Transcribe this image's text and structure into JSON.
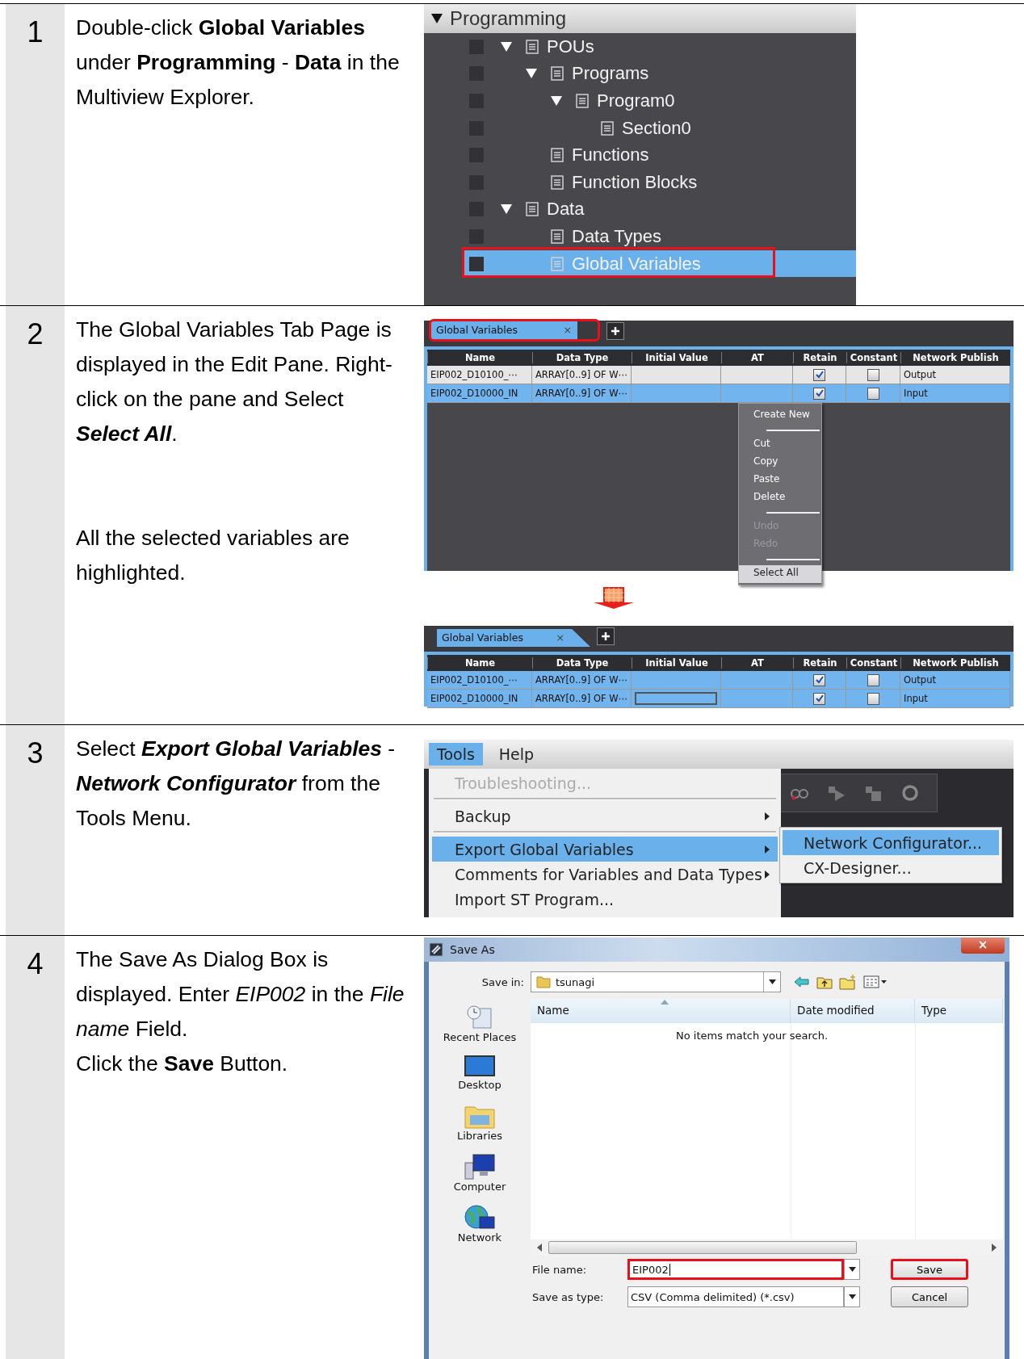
{
  "steps": [
    {
      "number": "1",
      "paragraphs": [
        {
          "kind": "note",
          "text": "Double-click **Global Variables** under **Programming** - **Data** in the Multiview Explorer."
        }
      ],
      "screens": [
        {
          "kind": "tree",
          "header": {
            "label": "Programming",
            "expanded": true
          },
          "items": [
            {
              "label": "POUs",
              "expanded": true,
              "selected": false,
              "marked": false,
              "children": [
                {
                  "label": "Programs",
                  "expanded": true,
                  "selected": false,
                  "marked": false,
                  "children": [
                    {
                      "label": "Program0",
                      "expanded": true,
                      "selected": false,
                      "marked": false,
                      "children": [
                        {
                          "label": "Section0",
                          "selected": false,
                          "marked": false
                        }
                      ]
                    }
                  ]
                },
                {
                  "label": "Functions",
                  "selected": false,
                  "marked": false
                },
                {
                  "label": "Function Blocks",
                  "selected": false,
                  "marked": false
                }
              ]
            },
            {
              "label": "Data",
              "expanded": true,
              "selected": false,
              "marked": false,
              "children": [
                {
                  "label": "Data Types",
                  "selected": false,
                  "marked": false
                },
                {
                  "label": "Global Variables",
                  "selected": true,
                  "marked": true
                }
              ]
            }
          ]
        }
      ]
    },
    {
      "number": "2",
      "paragraphs": [
        {
          "kind": "command",
          "text": "The Global Variables Tab Page is displayed in the Edit Pane. Right-click on the pane and Select **Select All**."
        },
        {
          "kind": "note",
          "text": "All the selected variables are highlighted."
        }
      ],
      "screens": [
        {
          "kind": "grid",
          "tabs": [
            {
              "label": "Global Variables",
              "close": "×",
              "selected": true,
              "marked": true
            }
          ],
          "columns": [
            "Name",
            "Data Type",
            "Initial Value",
            "AT",
            "Retain",
            "Constant",
            "Network Publish"
          ],
          "rows": [
            {
              "name": "EIP002_D10100_⋯",
              "data_type": "ARRAY[0..9] OF W⋯",
              "retain": true,
              "constant": false,
              "network_publish": "Output",
              "selected": false,
              "editing": false
            },
            {
              "name": "EIP002_D10000_IN",
              "data_type": "ARRAY[0..9] OF W⋯",
              "retain": true,
              "constant": false,
              "network_publish": "Input",
              "selected": true,
              "editing": false
            }
          ],
          "context_menu": [
            {
              "kind": "item",
              "label": "Create New",
              "disabled": false,
              "selected": false
            },
            {
              "kind": "separator"
            },
            {
              "kind": "item",
              "label": "Cut",
              "disabled": false,
              "selected": false
            },
            {
              "kind": "item",
              "label": "Copy",
              "disabled": false,
              "selected": false
            },
            {
              "kind": "item",
              "label": "Paste",
              "disabled": false,
              "selected": false
            },
            {
              "kind": "item",
              "label": "Delete",
              "disabled": false,
              "selected": false
            },
            {
              "kind": "separator"
            },
            {
              "kind": "item",
              "label": "Undo",
              "disabled": true,
              "selected": false
            },
            {
              "kind": "item",
              "label": "Redo",
              "disabled": true,
              "selected": false
            },
            {
              "kind": "separator"
            },
            {
              "kind": "item",
              "label": "Select All",
              "disabled": false,
              "selected": true
            }
          ]
        },
        {
          "kind": "arrow"
        },
        {
          "kind": "grid",
          "tabs": [
            {
              "label": "Global Variables",
              "close": "×",
              "selected": true,
              "marked": false
            }
          ],
          "columns": [
            "Name",
            "Data Type",
            "Initial Value",
            "AT",
            "Retain",
            "Constant",
            "Network Publish"
          ],
          "rows": [
            {
              "name": "EIP002_D10100_⋯",
              "data_type": "ARRAY[0..9] OF W⋯",
              "retain": true,
              "constant": false,
              "network_publish": "Output",
              "selected": true,
              "editing": false
            },
            {
              "name": "EIP002_D10000_IN",
              "data_type": "ARRAY[0..9] OF W⋯",
              "retain": true,
              "constant": false,
              "network_publish": "Input",
              "selected": true,
              "editing": true
            }
          ]
        }
      ]
    },
    {
      "number": "3",
      "paragraphs": [
        {
          "kind": "command",
          "text": "Select **Export Global Variables** - **Network Configurator** from the Tools Menu."
        }
      ],
      "screens": [
        {
          "kind": "menu",
          "menubar": [
            {
              "label": "Tools",
              "selected": true
            },
            {
              "label": "Help",
              "selected": false
            }
          ],
          "items": [
            {
              "kind": "item",
              "label": "Troubleshooting...",
              "disabled": true,
              "submenu": false,
              "selected": false
            },
            {
              "kind": "separator"
            },
            {
              "kind": "item",
              "label": "Backup",
              "disabled": false,
              "submenu": true,
              "selected": false
            },
            {
              "kind": "separator"
            },
            {
              "kind": "item",
              "label": "Export Global Variables",
              "disabled": false,
              "submenu": true,
              "selected": true
            },
            {
              "kind": "item",
              "label": "Comments for Variables and Data Types",
              "disabled": false,
              "submenu": true,
              "selected": false
            },
            {
              "kind": "item",
              "label": "Import ST Program...",
              "disabled": false,
              "submenu": false,
              "selected": false
            }
          ],
          "submenu": [
            {
              "label": "Network Configurator...",
              "selected": true
            },
            {
              "label": "CX-Designer...",
              "selected": false
            }
          ]
        }
      ]
    },
    {
      "number": "4",
      "paragraphs": [
        {
          "kind": "note",
          "text": "The Save As Dialog Box is displayed. Enter *EIP002* in the *File name* Field."
        },
        {
          "kind": "note",
          "text": "Click the **Save** Button."
        }
      ],
      "screens": [
        {
          "kind": "save_dialog",
          "title": "Save As",
          "close": "×",
          "save_in_label": "Save in:",
          "save_in": "tsunagi",
          "places": [
            "Recent Places",
            "Desktop",
            "Libraries",
            "Computer",
            "Network"
          ],
          "columns": [
            {
              "label": "Name",
              "sorted": true
            },
            {
              "label": "Date modified",
              "sorted": false
            },
            {
              "label": "Type",
              "sorted": false
            }
          ],
          "empty_message": "No items match your search.",
          "file_name_label": "File name:",
          "file_name": "EIP002",
          "file_name_marked": true,
          "type_label": "Save as type:",
          "type": "CSV (Comma delimited) (*.csv)",
          "buttons": [
            {
              "label": "Save",
              "marked": true
            },
            {
              "label": "Cancel",
              "marked": false
            }
          ]
        }
      ]
    }
  ]
}
